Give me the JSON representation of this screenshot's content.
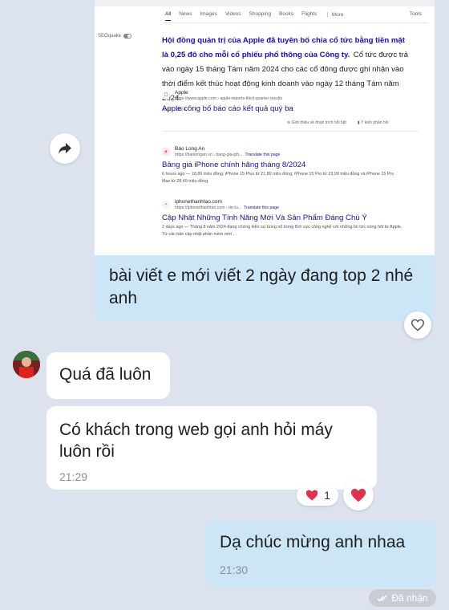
{
  "search_tabs": [
    "All",
    "News",
    "Images",
    "Videos",
    "Shopping",
    "Books",
    "Flights",
    "⋮ More",
    "Tools"
  ],
  "seoquake": "SEOquake",
  "featured": {
    "headline": "Hội đồng quản trị của Apple đã tuyên bố chia cổ tức bằng tiền mặt là 0,25 đô cho mỗi cổ phiếu phổ thông của Công ty.",
    "body": "Cổ tức được trả vào ngày 15 tháng Tám năm 2024 cho các cổ đông được ghi nhận vào thời điểm kết thúc hoạt động kinh doanh vào ngày 12 tháng Tám năm 2024.",
    "date": "Aug 1, 2024",
    "site": "Apple",
    "url": "https://www.apple.com › apple-reports-third-quarter-results",
    "link": "Apple công bố báo cáo kết quả quý ba",
    "about": "Giới thiệu về đoạn trích nổi bật",
    "feedback": "Ý kiến phản hồi"
  },
  "result1": {
    "site": "Báo Long An",
    "url": "https://baolongan.vn › bang-gia-iph...",
    "translate": "Translate this page",
    "title": "Bảng giá iPhone chính hãng tháng 8/2024",
    "desc": "6 hours ago — 18,89 triệu đồng; iPhone 15 Plus từ 21,89 triệu đồng; iPhone 15 Pro từ 23,99 triệu đồng và iPhone 15 Pro Max từ 28,49 triệu đồng."
  },
  "result2": {
    "site": "iphonethanhtao.com",
    "url": "https://iphonethanhtao.com › tin-tu...",
    "translate": "Translate this page",
    "title": "Cập Nhật Những Tính Năng Mới Và Sản Phẩm Đáng Chú Ý",
    "desc": "2 days ago — Tháng 8 năm 2024 đang chứng kiến sự bùng nổ trong lĩnh vực công nghệ với những tin tức nóng hổi từ Apple. Từ các bản cập nhật phần mềm mới ..."
  },
  "messages": {
    "sent_caption": "bài viết e mới viết 2 ngày đang top 2 nhé anh",
    "recv1": "Quá đã luôn",
    "recv2": "Có khách trong web gọi anh hỏi máy luôn rồi",
    "recv2_time": "21:29",
    "reaction_count": "1",
    "sent2": "Dạ chúc mừng anh nhaa",
    "sent2_time": "21:30",
    "status": "Đã nhận"
  },
  "colors": {
    "background": "#dde3ee",
    "sent_bubble": "#cde6f7",
    "link_blue": "#1a0dab",
    "heart_red": "#e0334a"
  }
}
